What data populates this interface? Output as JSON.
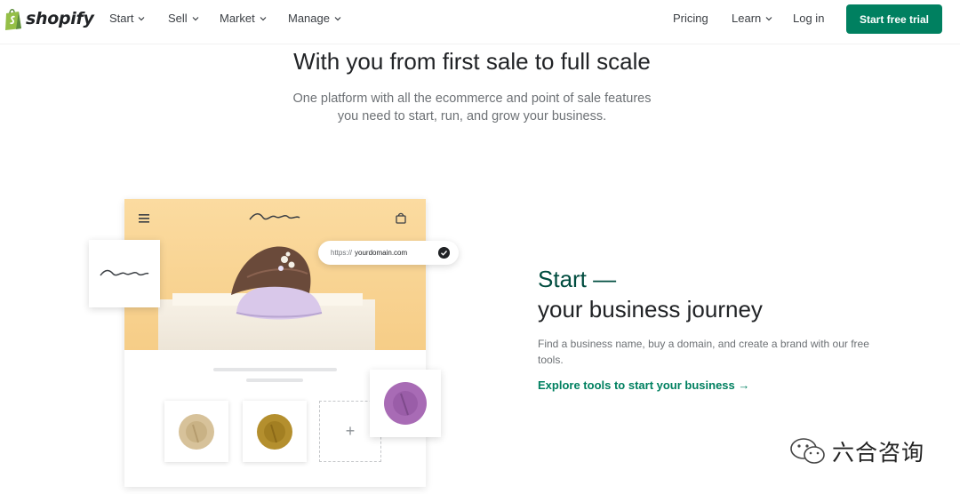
{
  "nav": {
    "brand": "shopify",
    "items": [
      {
        "label": "Start"
      },
      {
        "label": "Sell"
      },
      {
        "label": "Market"
      },
      {
        "label": "Manage"
      }
    ],
    "pricing": "Pricing",
    "learn": "Learn",
    "login": "Log in",
    "cta": "Start free trial"
  },
  "hero": {
    "title": "With you from first sale to full scale",
    "subtitle_line1": "One platform with all the ecommerce and point of sale features",
    "subtitle_line2": "you need to start, run, and grow your business."
  },
  "mockup": {
    "url_protocol": "https://",
    "url_domain": "yourdomain.com",
    "add_symbol": "+"
  },
  "section": {
    "heading_line1": "Start —",
    "heading_line2": "your business journey",
    "body": "Find a business name, buy a domain, and create a brand with our free tools.",
    "link": "Explore tools to start your business →"
  },
  "watermark": {
    "text": "六合咨询"
  },
  "colors": {
    "brand_green": "#008060",
    "heading_green": "#004c3f",
    "logo_green": "#95bf47",
    "mock_background": "#f6cd87",
    "purple_hat": "#a86bb5"
  }
}
